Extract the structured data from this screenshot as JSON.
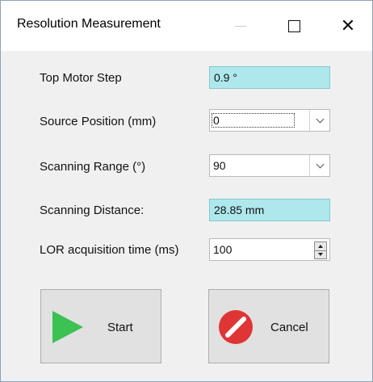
{
  "window": {
    "title": "Resolution Measurement",
    "controls": [
      "minimize",
      "maximize",
      "close"
    ]
  },
  "form": {
    "top_motor_step": {
      "label": "Top Motor Step",
      "value": "0.9 °"
    },
    "source_position": {
      "label": "Source Position (mm)",
      "value": "0"
    },
    "scanning_range": {
      "label": "Scanning Range (°)",
      "value": "90"
    },
    "scanning_distance": {
      "label": "Scanning Distance:",
      "value": "28.85 mm"
    },
    "lor_time": {
      "label": "LOR acquisition time (ms)",
      "value": "100"
    }
  },
  "buttons": {
    "start": {
      "label": "Start",
      "icon": "play-icon",
      "color": "#3cc153"
    },
    "cancel": {
      "label": "Cancel",
      "icon": "cancel-icon",
      "color": "#e03535"
    }
  },
  "colors": {
    "readonly_field_bg": "#aee8ec",
    "window_bg": "#f0f0f0"
  }
}
